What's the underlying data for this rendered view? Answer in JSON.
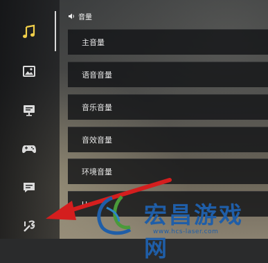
{
  "section": {
    "icon": "speaker-icon",
    "title": "音量"
  },
  "sidebar": {
    "items": [
      {
        "name": "music",
        "icon": "music-note-icon",
        "active": true
      },
      {
        "name": "display",
        "icon": "image-icon",
        "active": false
      },
      {
        "name": "interface",
        "icon": "monitor-icon",
        "active": false
      },
      {
        "name": "controls",
        "icon": "gamepad-icon",
        "active": false
      },
      {
        "name": "chat",
        "icon": "chat-icon",
        "active": false
      },
      {
        "name": "tools",
        "icon": "wrench-icon",
        "active": false
      }
    ]
  },
  "settings": {
    "rows": [
      {
        "label": "主音量"
      },
      {
        "label": "语音音量"
      },
      {
        "label": "音乐音量"
      },
      {
        "label": "音效音量"
      },
      {
        "label": "环境音量"
      },
      {
        "label": "U"
      }
    ]
  },
  "watermark": {
    "title": "宏昌游戏网",
    "url": "www.hcs-laser.com"
  },
  "colors": {
    "accent": "#f2d04a",
    "arrow": "#d41e1e",
    "watermark": "#1f5ea8"
  }
}
